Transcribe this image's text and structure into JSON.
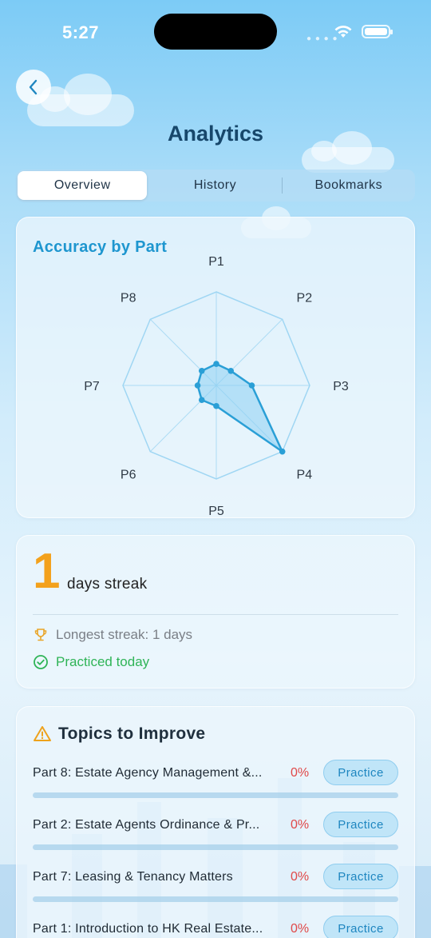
{
  "status_bar": {
    "time": "5:27"
  },
  "header": {
    "title": "Analytics"
  },
  "tabs": [
    {
      "label": "Overview",
      "active": true
    },
    {
      "label": "History",
      "active": false
    },
    {
      "label": "Bookmarks",
      "active": false
    }
  ],
  "accuracy": {
    "title": "Accuracy by Part"
  },
  "chart_data": {
    "type": "radar",
    "title": "Accuracy by Part",
    "categories": [
      "P1",
      "P2",
      "P3",
      "P4",
      "P5",
      "P6",
      "P7",
      "P8"
    ],
    "values": [
      0.23,
      0.22,
      0.38,
      1.0,
      0.22,
      0.22,
      0.2,
      0.22
    ],
    "range": [
      0,
      1
    ],
    "grid": "single outer ring with spokes",
    "colors": {
      "line": "#2a9fd6",
      "fill": "#8dd0f2",
      "grid": "#9fd6f3"
    }
  },
  "streak": {
    "count": "1",
    "label": "days streak",
    "longest": "Longest streak: 1 days",
    "today": "Practiced today"
  },
  "topics": {
    "title": "Topics to Improve",
    "practice_label": "Practice",
    "items": [
      {
        "name": "Part 8: Estate Agency Management &...",
        "percent": "0%",
        "progress": 0
      },
      {
        "name": "Part 2: Estate Agents Ordinance & Pr...",
        "percent": "0%",
        "progress": 0
      },
      {
        "name": "Part 7: Leasing & Tenancy Matters",
        "percent": "0%",
        "progress": 0
      },
      {
        "name": "Part 1: Introduction to HK Real Estate...",
        "percent": "0%",
        "progress": 0
      }
    ]
  },
  "colors": {
    "accent": "#1e96cf",
    "streak": "#f3a11c",
    "success": "#2fb457",
    "danger": "#e04848",
    "title": "#17476b"
  }
}
